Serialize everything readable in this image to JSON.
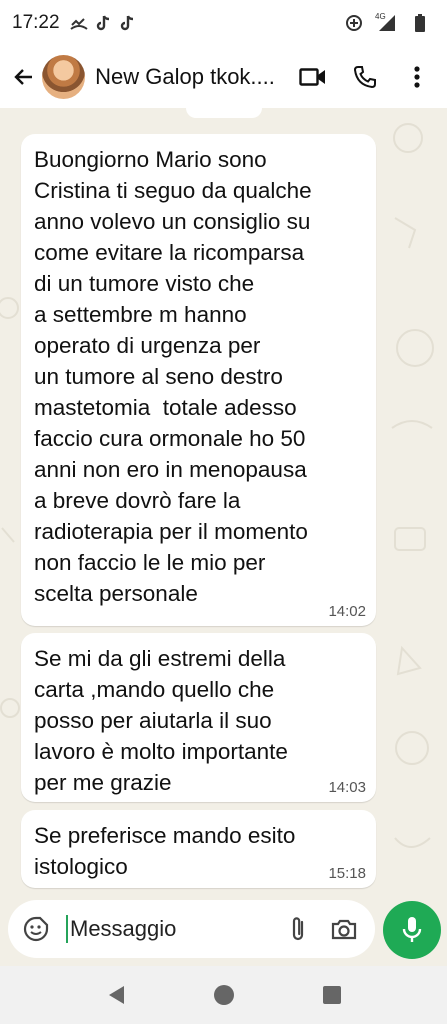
{
  "status_bar": {
    "time": "17:22",
    "left_icons": [
      "missed-call-icon",
      "tiktok-icon",
      "tiktok-icon"
    ],
    "right_icons": [
      "data-saver-icon",
      "signal-4g-icon",
      "battery-icon"
    ],
    "network_label": "4G"
  },
  "header": {
    "contact_name": "New Galop tkok....",
    "icons": [
      "back-arrow-icon",
      "video-call-icon",
      "phone-icon",
      "more-vert-icon"
    ]
  },
  "messages": [
    {
      "text": "Buongiorno Mario sono\nCristina ti seguo da qualche\nanno volevo un consiglio su\ncome evitare la ricomparsa\ndi un tumore visto che\na settembre m hanno\noperato di urgenza per\nun tumore al seno destro\nmastetomia  totale adesso\nfaccio cura ormonale ho 50\nanni non ero in menopausa\na breve dovrò fare la\nradioterapia per il momento\nnon faccio le le mio per\nscelta personale",
      "time": "14:02"
    },
    {
      "text": "Se mi da gli estremi della\ncarta ,mando quello che\nposso per aiutarla il suo\nlavoro è molto importante\nper me grazie",
      "time": "14:03"
    },
    {
      "text": "Se preferisce mando esito\nistologico",
      "time": "15:18"
    }
  ],
  "composer": {
    "placeholder": "Messaggio",
    "icons": [
      "sticker-icon",
      "attach-icon",
      "camera-icon",
      "mic-icon"
    ]
  },
  "colors": {
    "accent": "#1faa55",
    "chat_background": "#f2efe6",
    "bubble": "#ffffff"
  }
}
